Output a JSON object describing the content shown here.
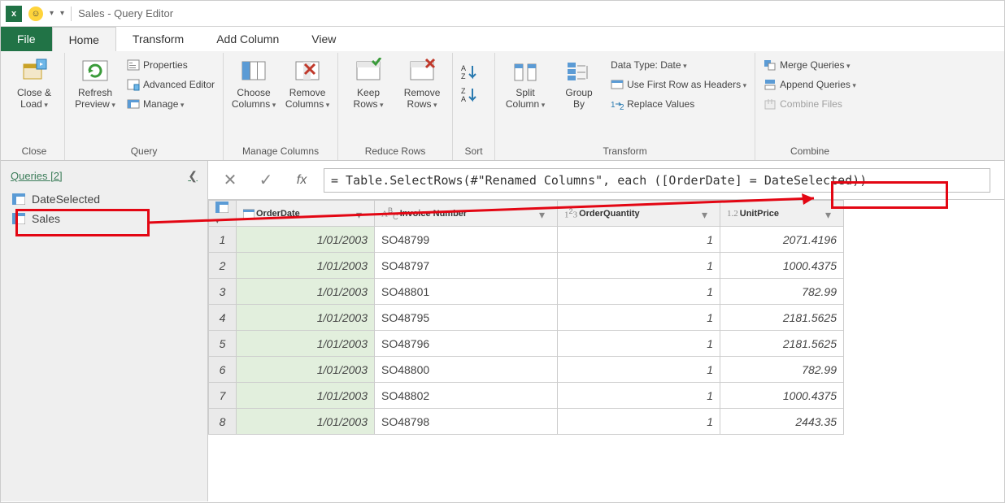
{
  "titlebar": {
    "title": "Sales - Query Editor"
  },
  "tabs": {
    "file": "File",
    "home": "Home",
    "transform": "Transform",
    "addcol": "Add Column",
    "view": "View"
  },
  "ribbon": {
    "close": {
      "close_load": "Close &\nLoad",
      "label": "Close"
    },
    "query": {
      "refresh": "Refresh\nPreview",
      "properties": "Properties",
      "advanced": "Advanced Editor",
      "manage": "Manage",
      "label": "Query"
    },
    "managecols": {
      "choose": "Choose\nColumns",
      "remove": "Remove\nColumns",
      "label": "Manage Columns"
    },
    "reducerows": {
      "keep": "Keep\nRows",
      "removerows": "Remove\nRows",
      "label": "Reduce Rows"
    },
    "sort": {
      "label": "Sort"
    },
    "transform": {
      "split": "Split\nColumn",
      "group": "Group\nBy",
      "datatype": "Data Type: Date",
      "firstrow": "Use First Row as Headers",
      "replace": "Replace Values",
      "label": "Transform"
    },
    "combine": {
      "merge": "Merge Queries",
      "append": "Append Queries",
      "combinefiles": "Combine Files",
      "label": "Combine"
    }
  },
  "queries": {
    "header": "Queries [2]",
    "items": [
      {
        "name": "DateSelected"
      },
      {
        "name": "Sales"
      }
    ]
  },
  "formula": "= Table.SelectRows(#\"Renamed Columns\", each ([OrderDate] = DateSelected))",
  "grid": {
    "columns": [
      {
        "name": "OrderDate",
        "type": "date"
      },
      {
        "name": "Invoice Number",
        "type": "text"
      },
      {
        "name": "OrderQuantity",
        "type": "int"
      },
      {
        "name": "UnitPrice",
        "type": "dec"
      }
    ],
    "rows": [
      {
        "n": "1",
        "date": "1/01/2003",
        "inv": "SO48799",
        "qty": "1",
        "price": "2071.4196"
      },
      {
        "n": "2",
        "date": "1/01/2003",
        "inv": "SO48797",
        "qty": "1",
        "price": "1000.4375"
      },
      {
        "n": "3",
        "date": "1/01/2003",
        "inv": "SO48801",
        "qty": "1",
        "price": "782.99"
      },
      {
        "n": "4",
        "date": "1/01/2003",
        "inv": "SO48795",
        "qty": "1",
        "price": "2181.5625"
      },
      {
        "n": "5",
        "date": "1/01/2003",
        "inv": "SO48796",
        "qty": "1",
        "price": "2181.5625"
      },
      {
        "n": "6",
        "date": "1/01/2003",
        "inv": "SO48800",
        "qty": "1",
        "price": "782.99"
      },
      {
        "n": "7",
        "date": "1/01/2003",
        "inv": "SO48802",
        "qty": "1",
        "price": "1000.4375"
      },
      {
        "n": "8",
        "date": "1/01/2003",
        "inv": "SO48798",
        "qty": "1",
        "price": "2443.35"
      }
    ]
  }
}
